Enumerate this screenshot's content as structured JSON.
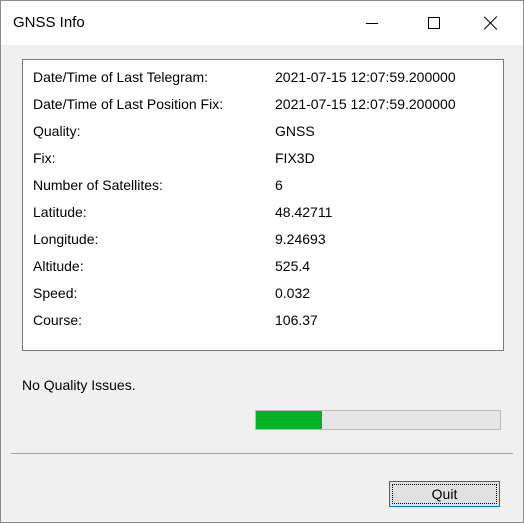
{
  "window": {
    "title": "GNSS Info"
  },
  "info": [
    {
      "label": "Date/Time of Last Telegram:",
      "value": "2021-07-15 12:07:59.200000"
    },
    {
      "label": "Date/Time of Last Position Fix:",
      "value": "2021-07-15 12:07:59.200000"
    },
    {
      "label": "Quality:",
      "value": "GNSS"
    },
    {
      "label": "Fix:",
      "value": "FIX3D"
    },
    {
      "label": "Number of Satellites:",
      "value": "6"
    },
    {
      "label": "Latitude:",
      "value": "48.42711"
    },
    {
      "label": "Longitude:",
      "value": "9.24693"
    },
    {
      "label": "Altitude:",
      "value": "525.4"
    },
    {
      "label": "Speed:",
      "value": "0.032"
    },
    {
      "label": "Course:",
      "value": "106.37"
    }
  ],
  "status": {
    "text": "No Quality Issues."
  },
  "progress": {
    "fraction": 0.27,
    "color": "#06b025"
  },
  "buttons": {
    "quit": "Quit"
  }
}
